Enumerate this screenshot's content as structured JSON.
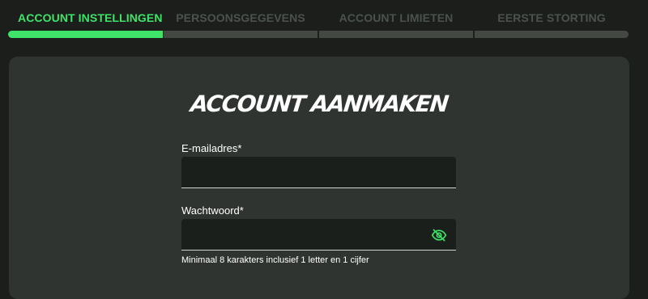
{
  "steps": [
    {
      "label": "ACCOUNT INSTELLINGEN",
      "active": true
    },
    {
      "label": "PERSOONSGEGEVENS",
      "active": false
    },
    {
      "label": "ACCOUNT LIMIETEN",
      "active": false
    },
    {
      "label": "EERSTE STORTING",
      "active": false
    }
  ],
  "form": {
    "title": "ACCOUNT AANMAKEN",
    "email_label": "E-mailadres*",
    "email_value": "",
    "password_label": "Wachtwoord*",
    "password_value": "",
    "password_toggle_icon": "eye-off-icon",
    "password_hint": "Minimaal 8 karakters inclusief 1 letter en 1 cijfer"
  },
  "colors": {
    "accent": "#3fe36a",
    "background": "#1b1e1b",
    "card": "#2f3430",
    "inactive": "#4b524c"
  }
}
